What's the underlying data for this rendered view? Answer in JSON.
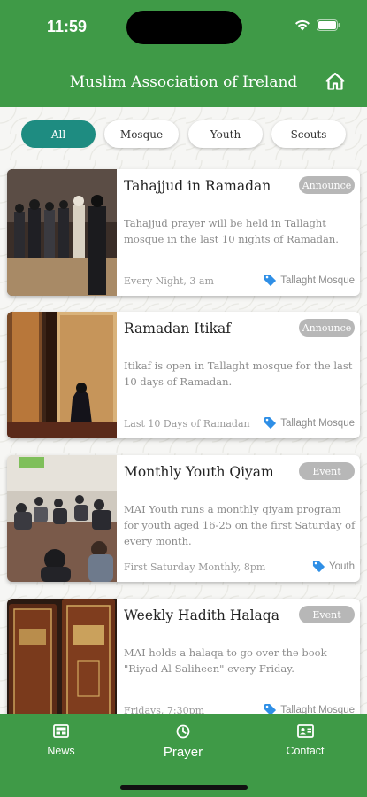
{
  "status": {
    "time": "11:59"
  },
  "header": {
    "title": "Muslim Association of Ireland",
    "home_icon": "home-icon"
  },
  "filters": [
    {
      "label": "All",
      "active": true
    },
    {
      "label": "Mosque",
      "active": false
    },
    {
      "label": "Youth",
      "active": false
    },
    {
      "label": "Scouts",
      "active": false
    }
  ],
  "cards": [
    {
      "title": "Tahajjud in Ramadan",
      "badge": "Announce",
      "description": "Tahajjud prayer will be held in Tallaght mosque in the last 10 nights of Ramadan.",
      "when": "Every Night, 3 am",
      "tag": "Tallaght Mosque"
    },
    {
      "title": "Ramadan Itikaf",
      "badge": "Announce",
      "description": "Itikaf is open in Tallaght mosque for the last 10 days of Ramadan.",
      "when": "Last 10 Days of Ramadan",
      "tag": "Tallaght Mosque"
    },
    {
      "title": "Monthly Youth Qiyam",
      "badge": "Event",
      "description": "MAI Youth runs a monthly qiyam program for youth aged 16-25 on the first Saturday of every month.",
      "when": "First Saturday Monthly, 8pm",
      "tag": "Youth"
    },
    {
      "title": "Weekly Hadith Halaqa",
      "badge": "Event",
      "description": "MAI holds a halaqa to go over the book \"Riyad Al Saliheen\" every Friday.",
      "when": "Fridays, 7:30pm",
      "tag": "Tallaght Mosque"
    }
  ],
  "tabs": [
    {
      "label": "News",
      "icon": "newspaper-icon"
    },
    {
      "label": "Prayer",
      "icon": "clock-icon"
    },
    {
      "label": "Contact",
      "icon": "contact-card-icon"
    }
  ],
  "colors": {
    "brand_green": "#3f9a47",
    "active_chip": "#1e8c81",
    "badge_grey": "#b7b7b7",
    "tag_blue": "#2f8fe6"
  }
}
